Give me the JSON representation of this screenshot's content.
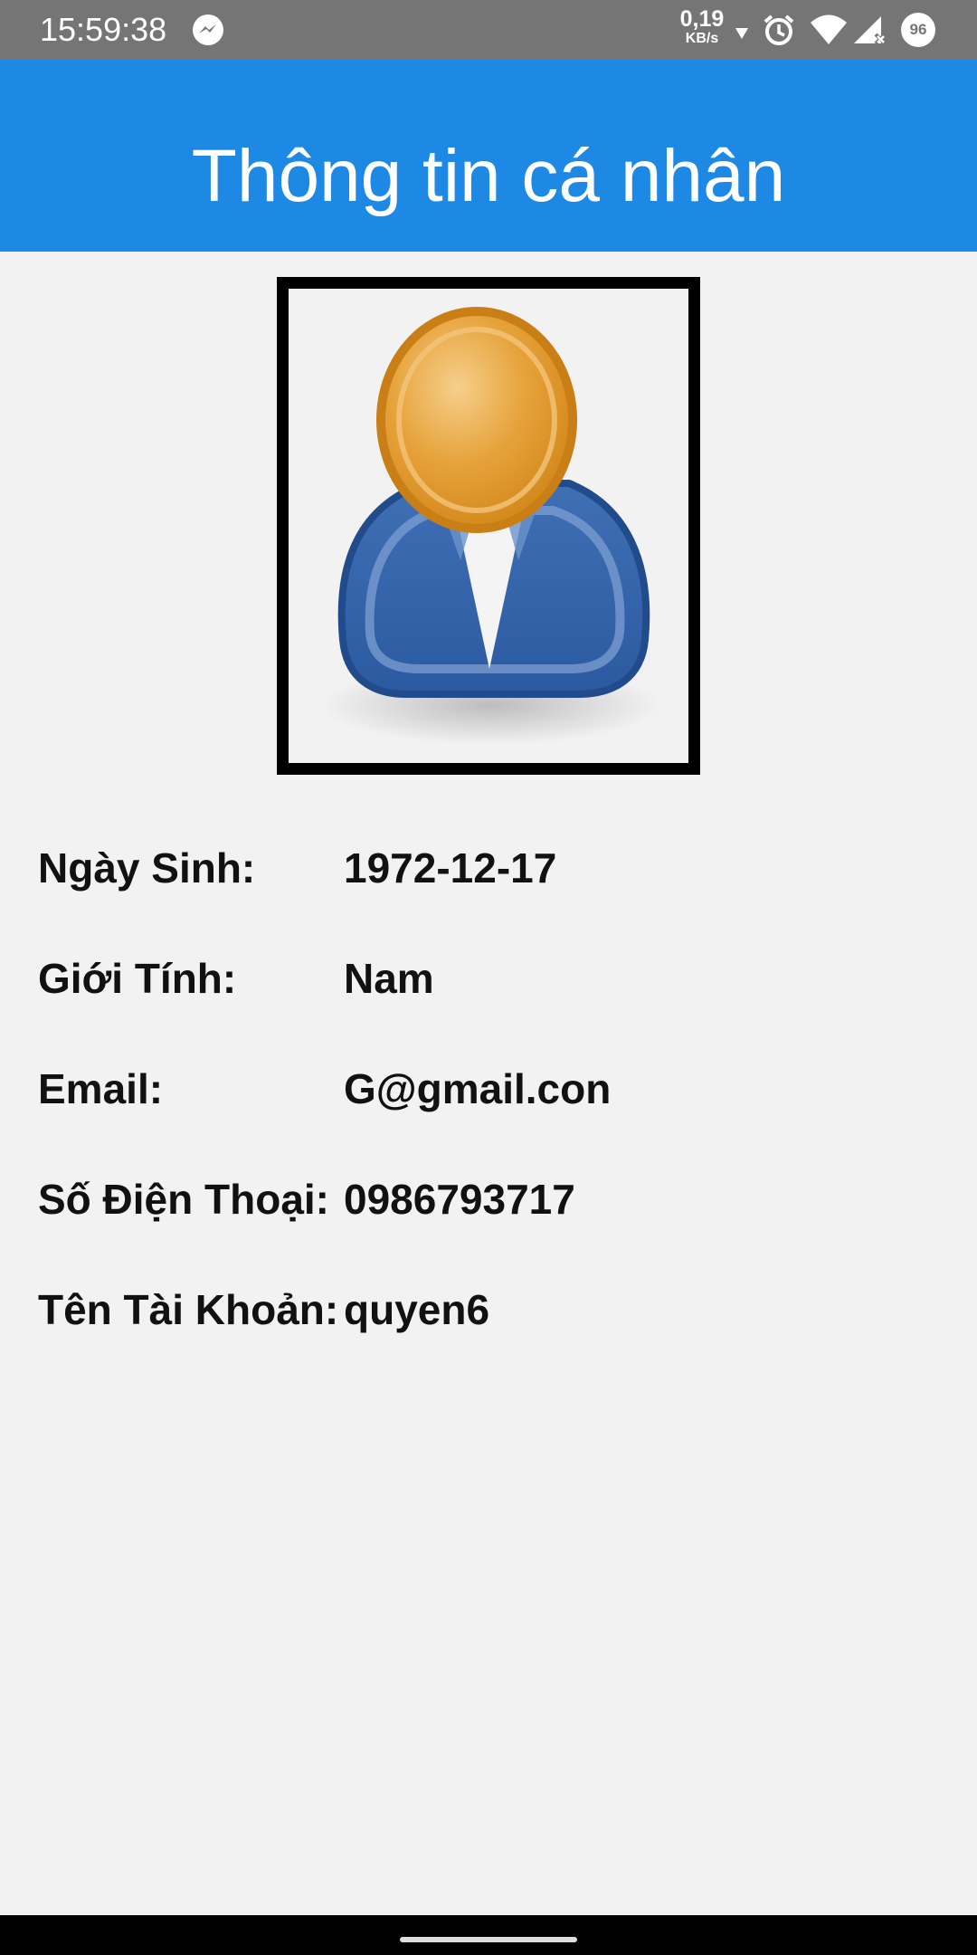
{
  "status_bar": {
    "time": "15:59:38",
    "net_speed_value": "0,19",
    "net_speed_unit": "KB/s",
    "battery_level": "96",
    "icons": [
      "messenger-icon",
      "data-arrow-icon",
      "alarm-icon",
      "wifi-icon",
      "cell-signal-icon",
      "battery-icon"
    ]
  },
  "header": {
    "title": "Thông tin cá nhân"
  },
  "profile": {
    "avatar_icon": "user-avatar-icon",
    "fields": [
      {
        "label": "Ngày Sinh:",
        "value": "1972-12-17"
      },
      {
        "label": "Giới Tính:",
        "value": "Nam"
      },
      {
        "label": "Email:",
        "value": "G@gmail.con"
      },
      {
        "label": "Số Điện Thoại:",
        "value": "0986793717"
      },
      {
        "label": "Tên Tài Khoản:",
        "value": "quyen6"
      }
    ]
  },
  "colors": {
    "app_bar": "#1e88e5",
    "status_bar": "#757575",
    "background": "#f2f2f2"
  }
}
